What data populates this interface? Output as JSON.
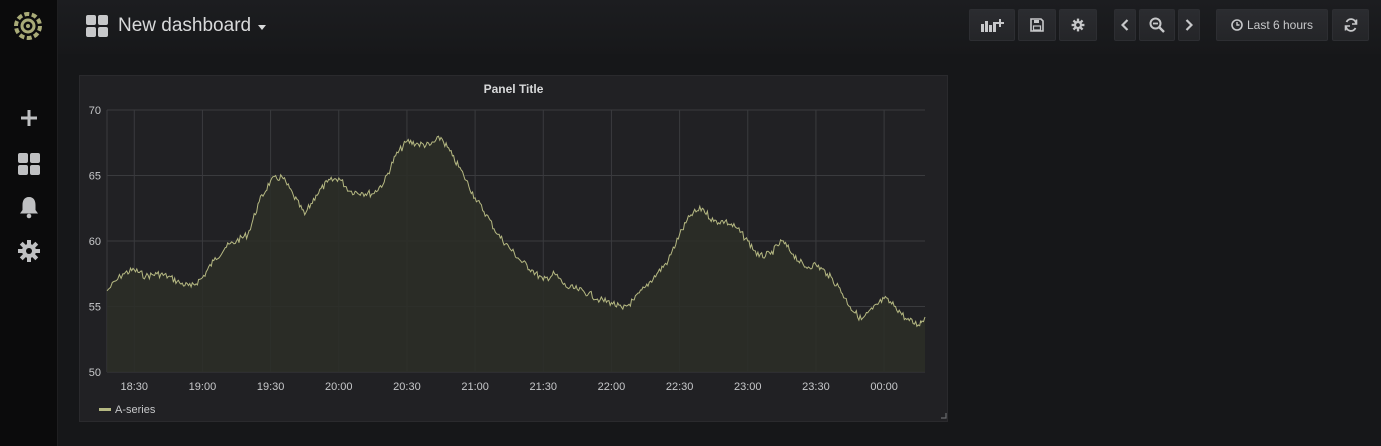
{
  "sidebar": {
    "logo_icon": "grafana-logo-icon",
    "items": [
      {
        "icon": "plus-icon",
        "name": "create"
      },
      {
        "icon": "dashboards-grid-icon",
        "name": "dashboards"
      },
      {
        "icon": "bell-icon",
        "name": "alerting"
      },
      {
        "icon": "gear-icon",
        "name": "configuration"
      }
    ]
  },
  "header": {
    "title": "New dashboard",
    "buttons": {
      "add_panel_icon": "add-panel-icon",
      "save_icon": "save-icon",
      "settings_icon": "gear-icon",
      "prev_icon": "chevron-left-icon",
      "zoom_icon": "zoom-out-icon",
      "next_icon": "chevron-right-icon",
      "time_range_label": "Last 6 hours",
      "refresh_icon": "refresh-icon"
    }
  },
  "panel": {
    "title": "Panel Title",
    "legend": [
      "A-series"
    ]
  },
  "colors": {
    "background": "#161719",
    "panel": "#212124",
    "series": "#b5b882",
    "series_fill": "#2b2e27",
    "grid": "#3a3b3e"
  },
  "chart_data": {
    "type": "area",
    "title": "Panel Title",
    "xlabel": "",
    "ylabel": "",
    "x_ticks": [
      "18:30",
      "19:00",
      "19:30",
      "20:00",
      "20:30",
      "21:00",
      "21:30",
      "22:00",
      "22:30",
      "23:00",
      "23:30",
      "00:00"
    ],
    "ylim": [
      50,
      70
    ],
    "y_ticks": [
      "50",
      "55",
      "60",
      "65",
      "70"
    ],
    "grid": true,
    "legend_position": "bottom-left",
    "series": [
      {
        "name": "A-series",
        "x": [
          "18:18",
          "18:25",
          "18:30",
          "18:35",
          "18:40",
          "18:45",
          "18:50",
          "18:55",
          "19:00",
          "19:05",
          "19:10",
          "19:15",
          "19:20",
          "19:25",
          "19:30",
          "19:35",
          "19:40",
          "19:45",
          "19:50",
          "19:55",
          "20:00",
          "20:05",
          "20:10",
          "20:15",
          "20:20",
          "20:25",
          "20:30",
          "20:35",
          "20:40",
          "20:45",
          "20:50",
          "20:55",
          "21:00",
          "21:05",
          "21:10",
          "21:15",
          "21:20",
          "21:25",
          "21:30",
          "21:35",
          "21:40",
          "21:45",
          "21:50",
          "21:55",
          "22:00",
          "22:05",
          "22:10",
          "22:15",
          "22:20",
          "22:25",
          "22:30",
          "22:35",
          "22:40",
          "22:45",
          "22:50",
          "22:55",
          "23:00",
          "23:05",
          "23:10",
          "23:15",
          "23:20",
          "23:25",
          "23:30",
          "23:35",
          "23:40",
          "23:45",
          "23:50",
          "23:55",
          "00:00",
          "00:05",
          "00:10",
          "00:15",
          "00:18"
        ],
        "values": [
          56.2,
          57.5,
          57.8,
          57.3,
          57.5,
          57.3,
          56.8,
          56.5,
          57.2,
          58.5,
          59.5,
          60.0,
          60.5,
          63.0,
          64.6,
          64.9,
          63.5,
          62.0,
          63.5,
          64.5,
          64.8,
          63.8,
          63.7,
          63.6,
          64.5,
          66.5,
          67.6,
          67.4,
          67.3,
          67.9,
          66.5,
          65.0,
          63.3,
          62.0,
          60.5,
          59.5,
          58.5,
          57.8,
          57.0,
          57.5,
          56.5,
          56.3,
          56.0,
          55.5,
          55.3,
          54.8,
          55.5,
          56.5,
          57.5,
          58.5,
          60.5,
          62.0,
          62.5,
          61.5,
          61.5,
          61.0,
          60.0,
          58.8,
          59.0,
          60.0,
          59.0,
          58.0,
          58.2,
          57.5,
          56.5,
          55.0,
          54.0,
          54.8,
          55.6,
          55.0,
          54.0,
          53.6,
          54.2
        ]
      }
    ]
  }
}
